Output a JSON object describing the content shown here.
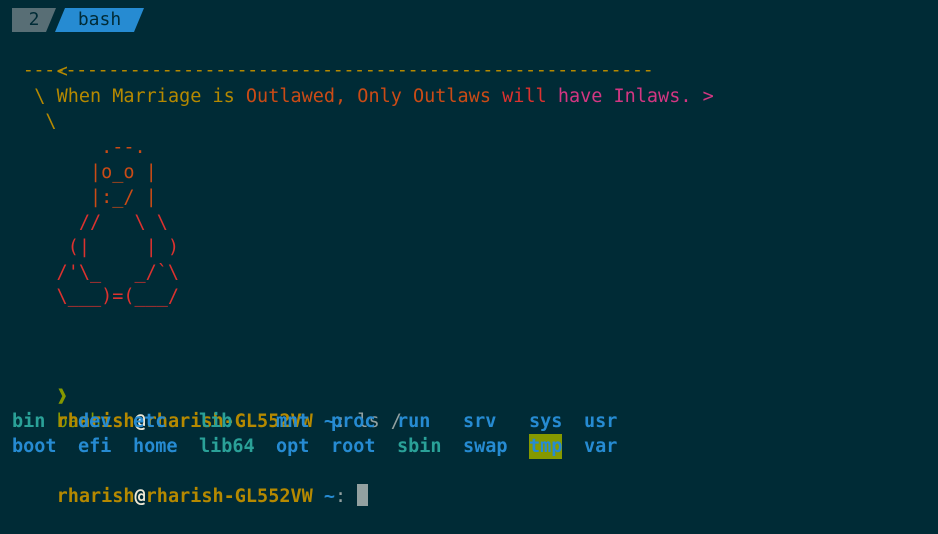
{
  "tabs": [
    {
      "label": "2"
    },
    {
      "label": "bash"
    }
  ],
  "fortune": {
    "open": "< ",
    "segments": [
      {
        "text": "When Marriage is ",
        "color": "#b58900"
      },
      {
        "text": "Outlawed, Only Outlaws ",
        "color": "#cb4b16"
      },
      {
        "text": "will ",
        "color": "#dc322f"
      },
      {
        "text": "have Inlaws. >",
        "color": "#d33682"
      }
    ],
    "dashes": " -----------------------------------------------------------",
    "tail1": "  \\",
    "tail2": "   \\"
  },
  "tux": [
    {
      "text": "        .--.",
      "color": "#cb4b16"
    },
    {
      "text": "       |o_o |",
      "color": "#cb4b16"
    },
    {
      "text": "       |:_/ |",
      "color": "#cb4b16"
    },
    {
      "text": "      //   \\ \\",
      "color": "#dc322f"
    },
    {
      "text": "     (|     | )",
      "color": "#dc322f"
    },
    {
      "text": "    /'\\_   _/`\\",
      "color": "#dc322f"
    },
    {
      "text": "    \\___)=(___/",
      "color": "#dc322f"
    }
  ],
  "shell": {
    "arrow": "❱",
    "name": "bash"
  },
  "prompt": {
    "user": "rharish",
    "at": "@",
    "host": "rharish-GL552VW",
    "path": " ~",
    "colon": ":"
  },
  "command": " ls /",
  "ls_rows": [
    [
      "bin",
      "dev",
      "etc",
      "lib",
      "mnt",
      "proc",
      "run",
      "srv",
      "sys",
      "usr"
    ],
    [
      "boot",
      "efi",
      "home",
      "lib64",
      "opt",
      "root",
      "sbin",
      "swap",
      "tmp",
      "var"
    ]
  ],
  "colors": {
    "background": "#002b36",
    "user": "#b58900",
    "at": "#eee8d5",
    "path": "#268bd2",
    "text": "#93a1a1",
    "arrow": "#859900",
    "dir": "#268bd2",
    "dir_alt": "#2aa198",
    "tmp_bg": "#859900"
  }
}
